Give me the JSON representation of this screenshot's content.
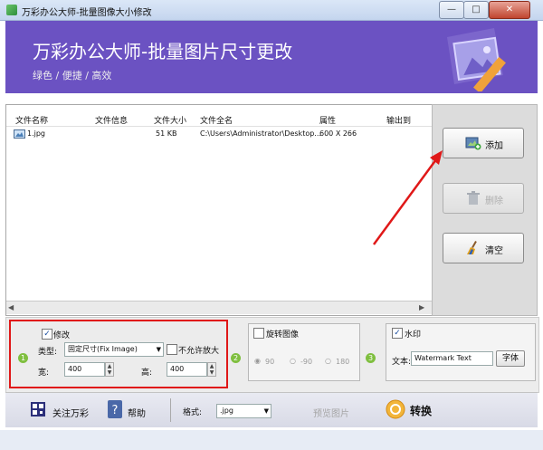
{
  "window": {
    "title": "万彩办公大师-批量图像大小修改",
    "min_label": "—",
    "max_label": "□",
    "close_label": "✕"
  },
  "banner": {
    "title": "万彩办公大师-批量图片尺寸更改",
    "subtitle": "绿色 / 便捷 / 高效",
    "bg_color": "#6b52c2"
  },
  "file_list": {
    "columns": [
      "文件名称",
      "文件信息",
      "文件大小",
      "文件全名",
      "属性",
      "输出到"
    ],
    "rows": [
      {
        "name": "1.jpg",
        "info": "",
        "size": "51 KB",
        "fullname": "C:\\Users\\Administrator\\Desktop...",
        "attr": "600 X 266",
        "output": ""
      }
    ]
  },
  "side_buttons": {
    "add": "添加",
    "delete": "删除",
    "clear": "清空"
  },
  "resize": {
    "checkbox_label": "修改",
    "checked": true,
    "type_label": "类型:",
    "type_value": "固定尺寸(Fix Image)",
    "no_enlarge_label": "不允许放大",
    "width_label": "宽:",
    "width_value": "400",
    "height_label": "高:",
    "height_value": "400",
    "step": "1"
  },
  "rotate": {
    "checkbox_label": "旋转图像",
    "options": [
      "90",
      "-90",
      "180"
    ],
    "step": "2"
  },
  "watermark": {
    "checkbox_label": "水印",
    "checked": true,
    "text_label": "文本:",
    "text_value": "Watermark Text",
    "font_button": "字体",
    "step": "3"
  },
  "toolbar": {
    "follow": "关注万彩",
    "help": "帮助",
    "format_label": "格式:",
    "format_value": ".jpg",
    "preview": "预览图片",
    "convert": "转换"
  },
  "colors": {
    "accent": "#6b52c2",
    "highlight": "#e01818",
    "arrow": "#e01818"
  }
}
